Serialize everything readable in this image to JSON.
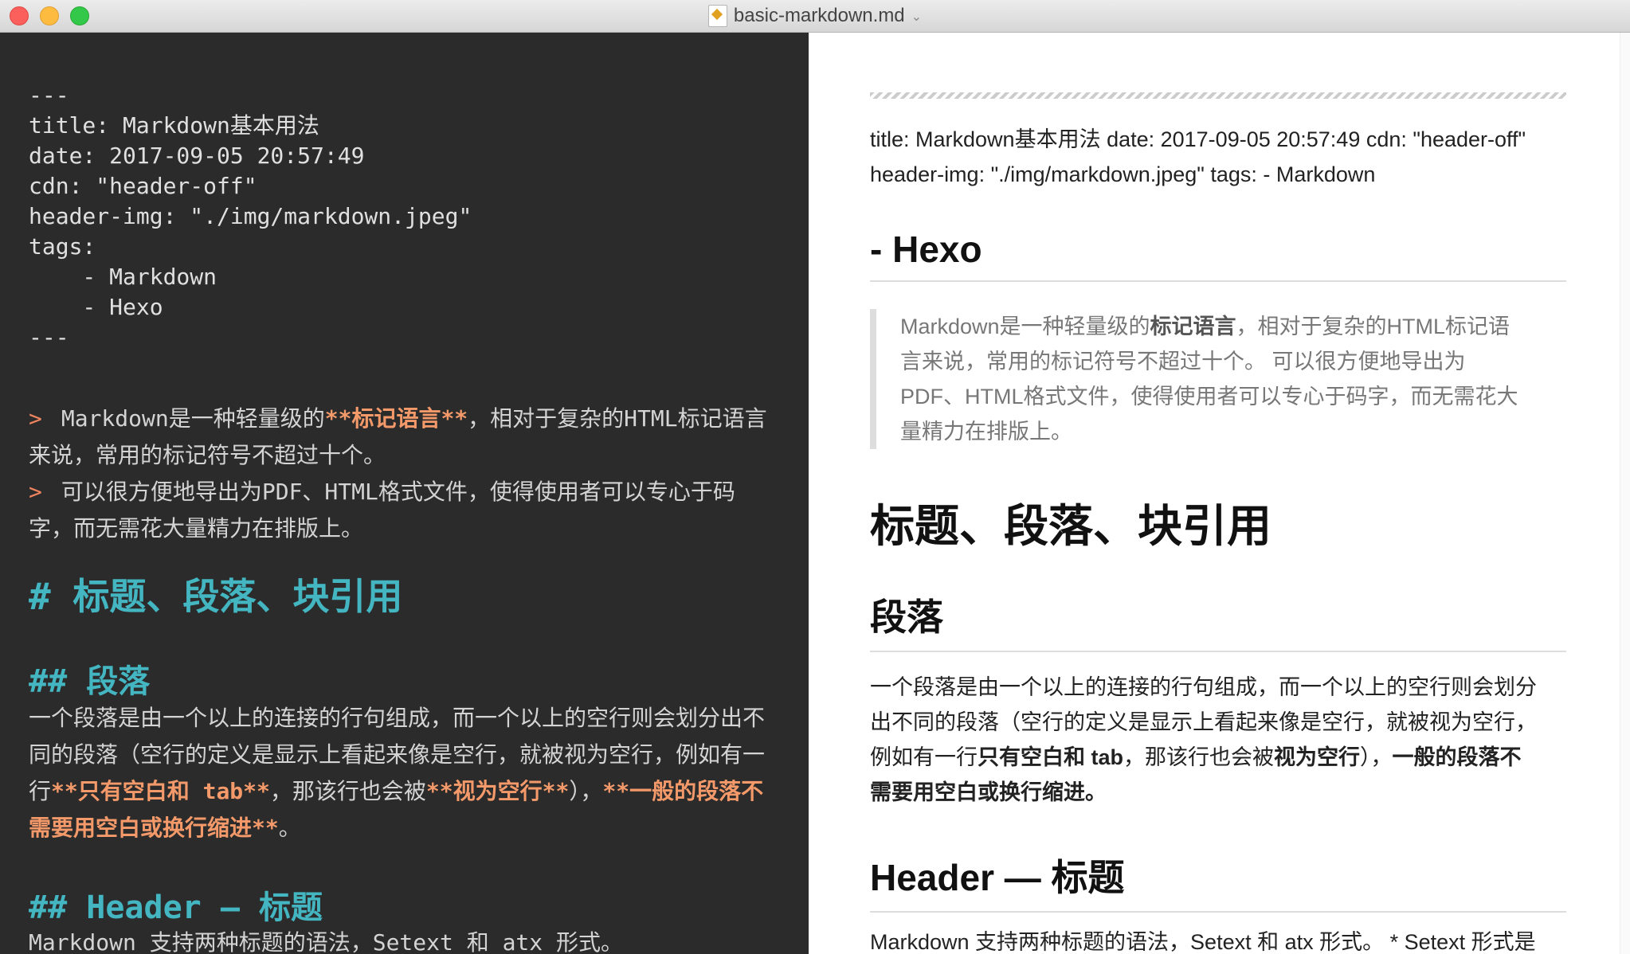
{
  "window": {
    "title": "basic-markdown.md"
  },
  "editor": {
    "frontmatter": [
      "---",
      "title: Markdown基本用法",
      "date: 2017-09-05 20:57:49",
      "cdn: \"header-off\"",
      "header-img: \"./img/markdown.jpeg\"",
      "tags:",
      "    - Markdown",
      "    - Hexo",
      "---"
    ],
    "quote": {
      "gt": ">",
      "l1a": "Markdown是一种轻量级的",
      "l1b": "**标记语言**",
      "l1c": "，相对于复杂的HTML标记语言",
      "l2": "来说，常用的标记符号不超过十个。",
      "l3": "可以很方便地导出为PDF、HTML格式文件，使得使用者可以专心于码",
      "l4": "字，而无需花大量精力在排版上。"
    },
    "h1": "# 标题、段落、块引用",
    "h2_para": "## 段落",
    "para": {
      "l1": "一个段落是由一个以上的连接的行句组成，而一个以上的空行则会划分出不",
      "l2": "同的段落（空行的定义是显示上看起来像是空行，就被视为空行，例如有一",
      "l3a": "行",
      "l3b": "**只有空白和 tab**",
      "l3c": "，那该行也会被",
      "l3d": "**视为空行**",
      "l3e": "），",
      "l3f": "**一般的段落不",
      "l4a": "需要用空白或换行缩进**",
      "l4b": "。"
    },
    "h2_header": "## Header — 标题",
    "last_line": "Markdown 支持两种标题的语法，Setext 和 atx 形式。"
  },
  "preview": {
    "meta_l1": "title: Markdown基本用法 date: 2017-09-05 20:57:49 cdn: \"header-off\"",
    "meta_l2": "header-img: \"./img/markdown.jpeg\" tags: - Markdown",
    "h_hexo": "- Hexo",
    "quote": {
      "l1a": "Markdown是一种轻量级的",
      "l1b": "标记语言",
      "l1c": "，相对于复杂的HTML标记语",
      "l2": "言来说，常用的标记符号不超过十个。 可以很方便地导出为",
      "l3": "PDF、HTML格式文件，使得使用者可以专心于码字，而无需花大",
      "l4": "量精力在排版上。"
    },
    "h1": "标题、段落、块引用",
    "h2_para": "段落",
    "para": {
      "l1": "一个段落是由一个以上的连接的行句组成，而一个以上的空行则会划分",
      "l2": "出不同的段落（空行的定义是显示上看起来像是空行，就被视为空行，",
      "l3a": "例如有一行",
      "l3b": "只有空白和 tab",
      "l3c": "，那该行也会被",
      "l3d": "视为空行",
      "l3e": "），",
      "l3f": "一般的段落不",
      "l4": "需要用空白或换行缩进。"
    },
    "h2_header": "Header — 标题",
    "last_line": "Markdown 支持两种标题的语法，Setext 和 atx 形式。 * Setext 形式是"
  }
}
